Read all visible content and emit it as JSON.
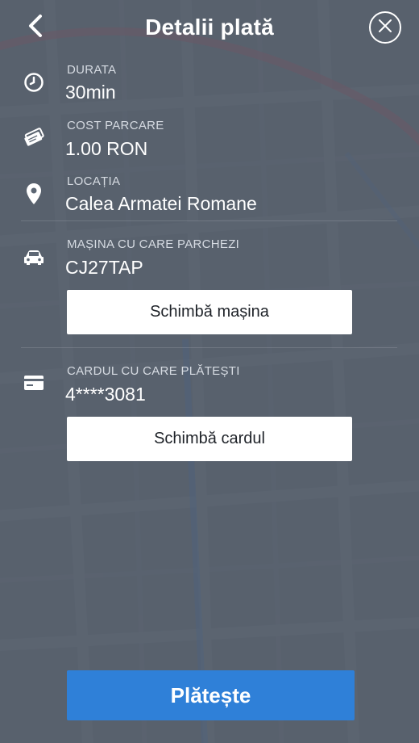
{
  "header": {
    "title": "Detalii plată",
    "back_icon": "chevron-left-icon",
    "close_icon": "close-circle-icon"
  },
  "details": {
    "duration": {
      "label": "DURATA",
      "value": "30min",
      "icon": "clock-icon"
    },
    "cost": {
      "label": "COST PARCARE",
      "value": "1.00 RON",
      "icon": "tickets-icon"
    },
    "location": {
      "label": "LOCAȚIA",
      "value": "Calea Armatei Romane",
      "icon": "location-pin-icon"
    }
  },
  "car": {
    "label": "MAȘINA CU CARE PARCHEZI",
    "value": "CJ27TAP",
    "icon": "car-icon",
    "change_button": "Schimbă mașina"
  },
  "card": {
    "label": "CARDUL CU CARE PLĂTEȘTI",
    "value": "4****3081",
    "icon": "credit-card-icon",
    "change_button": "Schimbă cardul"
  },
  "pay_button": "Plătește",
  "colors": {
    "overlay": "#525b68",
    "primary": "#2f80d8",
    "route_red": "#b5576a",
    "route_blue": "#4a7fc0"
  }
}
